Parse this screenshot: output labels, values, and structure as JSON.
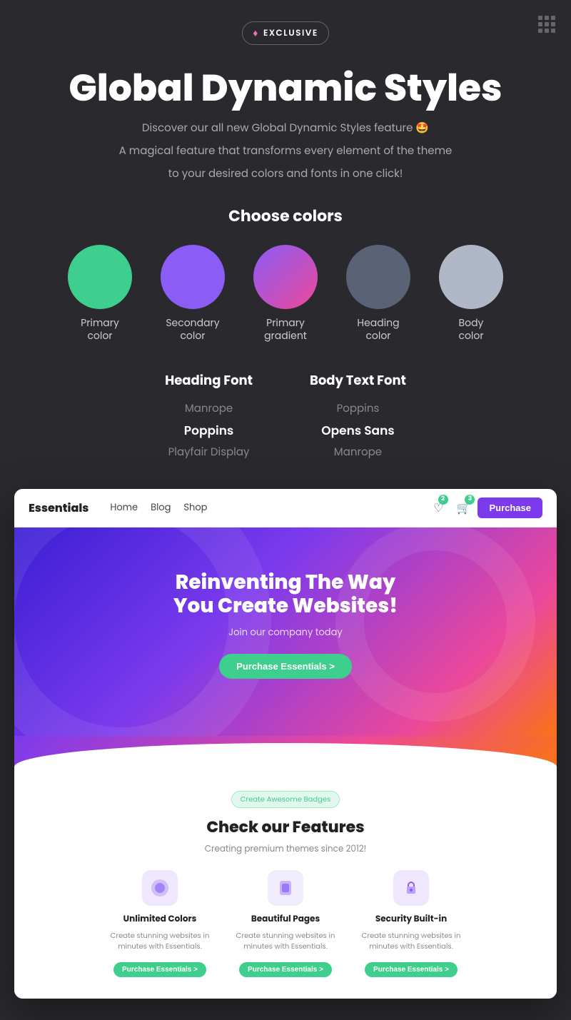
{
  "page": {
    "background_color": "#2a2a2e"
  },
  "exclusive_badge": {
    "label": "EXCLUSIVE",
    "diamond_icon": "♦"
  },
  "main_title": "Global Dynamic Styles",
  "subtitles": {
    "line1": "Discover our all new Global Dynamic Styles feature 🤩",
    "line2": "A magical feature that transforms every element of the theme",
    "line3": "to your desired colors and fonts in one click!"
  },
  "choose_colors": {
    "section_title": "Choose colors",
    "colors": [
      {
        "id": "primary",
        "label": "Primary\ncolor",
        "css_class": "circle-primary"
      },
      {
        "id": "secondary",
        "label": "Secondary\ncolor",
        "css_class": "circle-secondary"
      },
      {
        "id": "gradient",
        "label": "Primary\ngradient",
        "css_class": "circle-gradient"
      },
      {
        "id": "heading",
        "label": "Heading\ncolor",
        "css_class": "circle-heading"
      },
      {
        "id": "body",
        "label": "Body\ncolor",
        "css_class": "circle-body"
      }
    ]
  },
  "fonts": {
    "heading_font": {
      "title": "Heading Font",
      "options": [
        "Manrope",
        "Poppins",
        "Playfair Display"
      ],
      "active": "Poppins"
    },
    "body_font": {
      "title": "Body Text Font",
      "options": [
        "Poppins",
        "Opens Sans",
        "Manrope"
      ],
      "active": "Opens Sans"
    }
  },
  "preview": {
    "navbar": {
      "logo": "Essentials",
      "links": [
        "Home",
        "Blog",
        "Shop"
      ],
      "wishlist_count": "2",
      "cart_count": "3",
      "purchase_btn": "Purchase"
    },
    "hero": {
      "title_line1": "Reinventing The Way",
      "title_line2": "You Create Websites!",
      "subtitle": "Join our company today",
      "cta_btn": "Purchase Essentials  >"
    },
    "features_badge": "Create Awesome Badges",
    "features_title": "Check our Features",
    "features_subtitle": "Creating premium themes since 2012!",
    "features": [
      {
        "icon": "🔵",
        "title": "Unlimited Colors",
        "desc": "Create stunning websites in minutes with Essentials.",
        "btn": "Purchase Essentials >"
      },
      {
        "icon": "🟣",
        "title": "Beautiful Pages",
        "desc": "Create stunning websites in minutes with Essentials.",
        "btn": "Purchase Essentials >"
      },
      {
        "icon": "🔒",
        "title": "Security Built-in",
        "desc": "Create stunning websites in minutes with Essentials.",
        "btn": "Purchase Essentials >"
      }
    ]
  },
  "top_right_icon": "trellis"
}
